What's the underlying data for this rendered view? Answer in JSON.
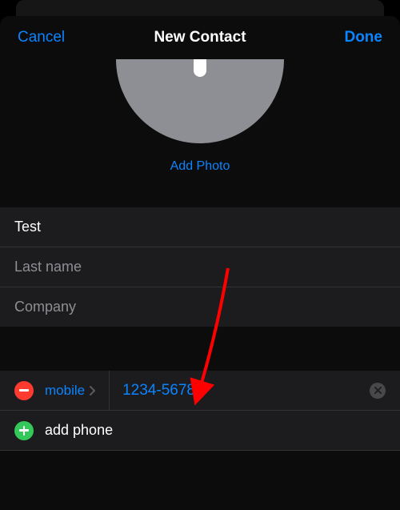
{
  "header": {
    "cancel": "Cancel",
    "title": "New Contact",
    "done": "Done"
  },
  "photo": {
    "add_label": "Add Photo"
  },
  "fields": {
    "first_name_value": "Test",
    "last_name_placeholder": "Last name",
    "company_placeholder": "Company"
  },
  "phone": {
    "type_label": "mobile",
    "value": "1234-56789",
    "add_label": "add phone"
  }
}
